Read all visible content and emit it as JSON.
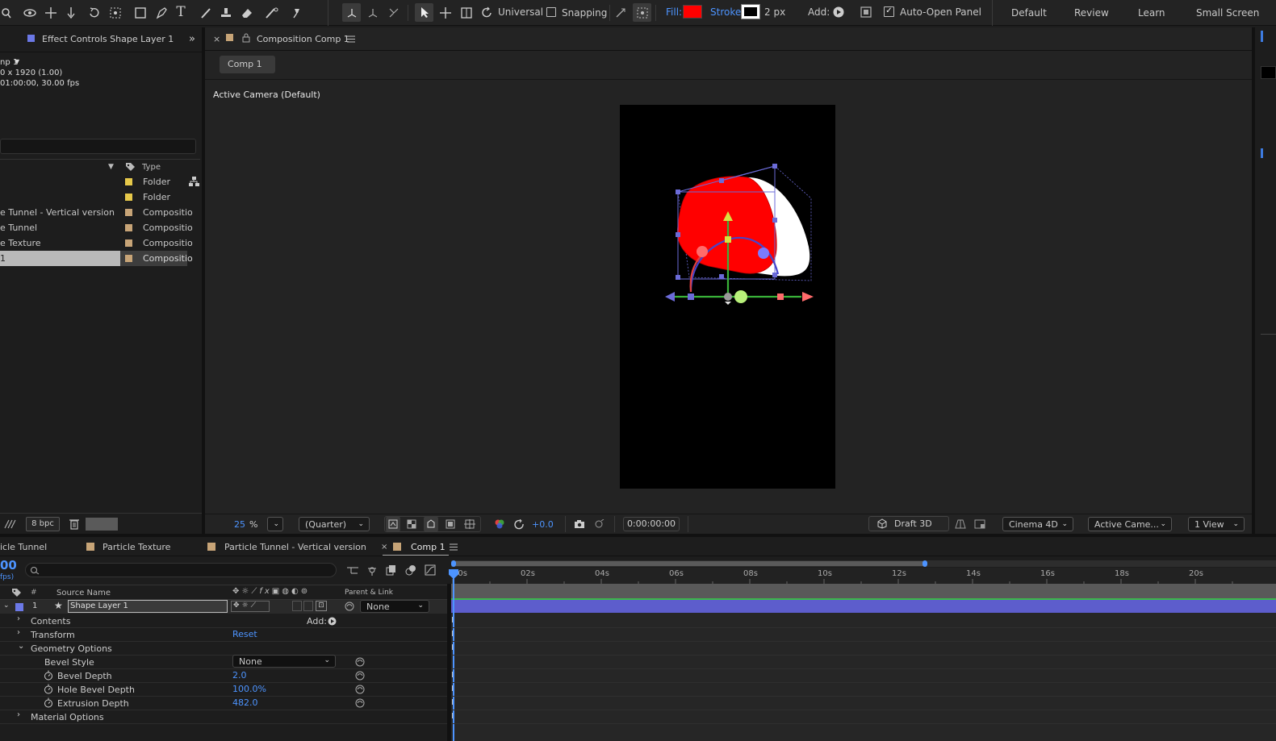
{
  "toolbar": {
    "universal_label": "Universal",
    "snapping_label": "Snapping",
    "fill_label": "Fill:",
    "stroke_label": "Stroke:",
    "stroke_width": "2 px",
    "add_label": "Add:",
    "auto_open_label": "Auto-Open Panel",
    "fill_color": "#ff0000",
    "workspaces": [
      "Default",
      "Review",
      "Learn",
      "Small Screen"
    ]
  },
  "project_panel": {
    "tab_title": "Effect Controls Shape Layer 1",
    "comp_name": "np 1",
    "comp_size": "0 x 1920 (1.00)",
    "comp_duration": "01:00:00, 30.00 fps",
    "type_header": "Type",
    "items": [
      {
        "name": "",
        "type": "Folder",
        "color": "#e6c84a"
      },
      {
        "name": "",
        "type": "Folder",
        "color": "#e6c84a"
      },
      {
        "name": "e Tunnel - Vertical version",
        "type": "Compositio",
        "color": "#c7a477"
      },
      {
        "name": "e Tunnel",
        "type": "Compositio",
        "color": "#c7a477"
      },
      {
        "name": "e Texture",
        "type": "Compositio",
        "color": "#c7a477"
      },
      {
        "name": "1",
        "type": "Compositio",
        "color": "#c7a477"
      }
    ],
    "bpc": "8 bpc"
  },
  "comp_panel": {
    "tab_title": "Composition Comp 1",
    "breadcrumb": "Comp 1",
    "camera_label": "Active Camera (Default)",
    "zoom": "25",
    "zoom_unit": "%",
    "resolution": "(Quarter)",
    "exposure": "+0.0",
    "timecode": "0:00:00:00",
    "draft": "Draft 3D",
    "renderer": "Cinema 4D",
    "camera_select": "Active Came...",
    "views": "1 View"
  },
  "timeline": {
    "tabs": [
      "icle Tunnel",
      "Particle Texture",
      "Particle Tunnel - Vertical version",
      "Comp 1"
    ],
    "time_display": "00",
    "fps_display": "fps)",
    "col_number": "#",
    "col_source": "Source Name",
    "col_parent": "Parent & Link",
    "layer_number": "1",
    "layer_name": "Shape Layer 1",
    "parent_value": "None",
    "ruler_labels": [
      "00s",
      "02s",
      "04s",
      "06s",
      "08s",
      "10s",
      "12s",
      "14s",
      "16s",
      "18s",
      "20s"
    ],
    "properties": {
      "contents": "Contents",
      "add_label": "Add:",
      "transform": "Transform",
      "reset_label": "Reset",
      "geometry": "Geometry Options",
      "bevel_style": "Bevel Style",
      "bevel_style_value": "None",
      "bevel_depth": "Bevel Depth",
      "bevel_depth_value": "2.0",
      "hole_bevel": "Hole Bevel Depth",
      "hole_bevel_value": "100.0%",
      "extrusion": "Extrusion Depth",
      "extrusion_value": "482.0",
      "material": "Material Options"
    }
  }
}
